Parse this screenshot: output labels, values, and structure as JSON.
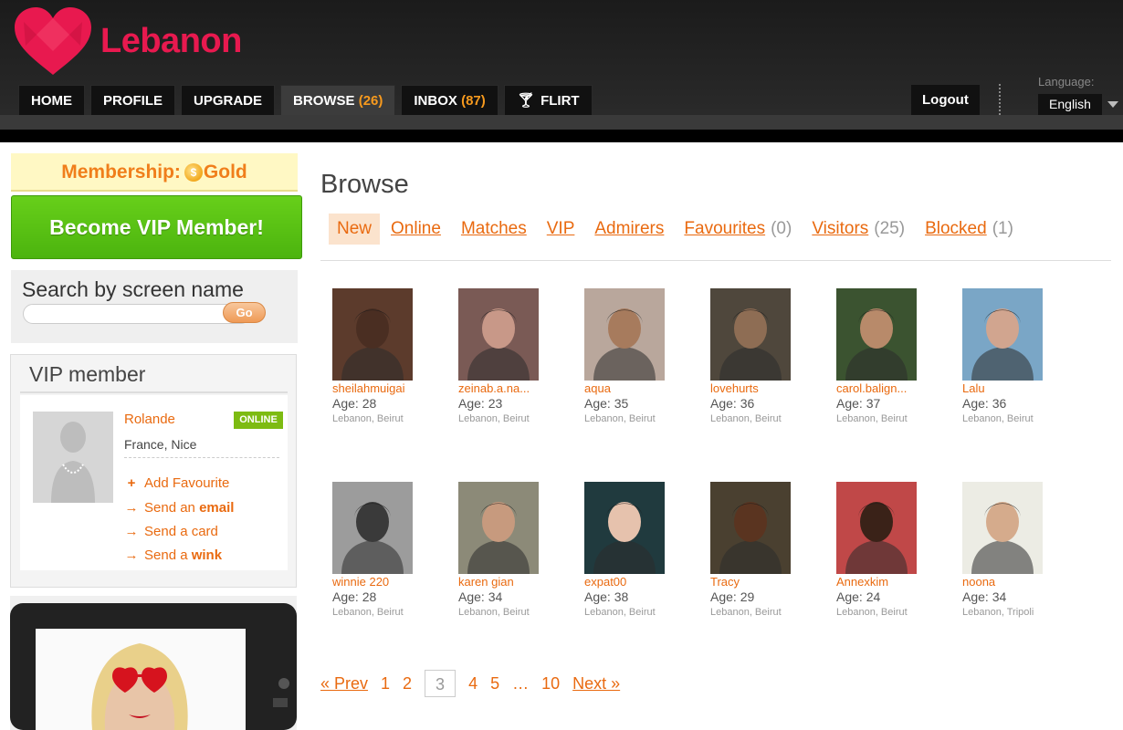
{
  "header": {
    "logo_text": "Lebanon",
    "nav": [
      {
        "label": "HOME",
        "count": ""
      },
      {
        "label": "PROFILE",
        "count": ""
      },
      {
        "label": "UPGRADE",
        "count": ""
      },
      {
        "label": "BROWSE",
        "count": "(26)"
      },
      {
        "label": "INBOX",
        "count": "(87)"
      },
      {
        "label": "FLIRT",
        "count": ""
      }
    ],
    "logout_label": "Logout",
    "language_label": "Language:",
    "language_value": "English"
  },
  "sidebar": {
    "membership_prefix": "Membership:",
    "membership_level": "Gold",
    "vip_button_label": "Become VIP Member!",
    "search_title": "Search by screen name",
    "search_value": "",
    "go_label": "Go",
    "vip_section_title": "VIP member",
    "vip_member": {
      "name": "Rolande",
      "status": "ONLINE",
      "location": "France, Nice",
      "actions": [
        {
          "glyph": "+",
          "text": "Add Favourite",
          "bold": ""
        },
        {
          "glyph": "→",
          "text": "Send an ",
          "bold": "email"
        },
        {
          "glyph": "→",
          "text": "Send a card",
          "bold": ""
        },
        {
          "glyph": "→",
          "text": "Send a ",
          "bold": "wink"
        }
      ]
    }
  },
  "main": {
    "title": "Browse",
    "tabs": [
      {
        "label": "New",
        "count": ""
      },
      {
        "label": "Online",
        "count": ""
      },
      {
        "label": "Matches",
        "count": ""
      },
      {
        "label": "VIP",
        "count": ""
      },
      {
        "label": "Admirers",
        "count": ""
      },
      {
        "label": "Favourites",
        "count": "(0)"
      },
      {
        "label": "Visitors",
        "count": "(25)"
      },
      {
        "label": "Blocked",
        "count": "(1)"
      }
    ],
    "profiles": [
      {
        "name": "sheilahmuigai",
        "age": "Age: 28",
        "location": "Lebanon, Beirut",
        "bg": "#5c3b2c",
        "skin": "#4a2e22"
      },
      {
        "name": "zeinab.a.na...",
        "age": "Age: 23",
        "location": "Lebanon, Beirut",
        "bg": "#7a5a55",
        "skin": "#c89888"
      },
      {
        "name": "aqua",
        "age": "Age: 35",
        "location": "Lebanon, Beirut",
        "bg": "#b9a79c",
        "skin": "#a77b5d"
      },
      {
        "name": "lovehurts",
        "age": "Age: 36",
        "location": "Lebanon, Beirut",
        "bg": "#4f473c",
        "skin": "#8e6d54"
      },
      {
        "name": "carol.balign...",
        "age": "Age: 37",
        "location": "Lebanon, Beirut",
        "bg": "#3b5330",
        "skin": "#b88a6a"
      },
      {
        "name": "Lalu",
        "age": "Age: 36",
        "location": "Lebanon, Beirut",
        "bg": "#7aa6c6",
        "skin": "#d1a58f"
      },
      {
        "name": "winnie 220",
        "age": "Age: 28",
        "location": "Lebanon, Beirut",
        "bg": "#9c9c9c",
        "skin": "#3a3a3a"
      },
      {
        "name": "karen gian",
        "age": "Age: 34",
        "location": "Lebanon, Beirut",
        "bg": "#8c8a78",
        "skin": "#c79a7e"
      },
      {
        "name": "expat00",
        "age": "Age: 38",
        "location": "Lebanon, Beirut",
        "bg": "#203a3e",
        "skin": "#e6c2ad"
      },
      {
        "name": "Tracy",
        "age": "Age: 29",
        "location": "Lebanon, Beirut",
        "bg": "#4a4030",
        "skin": "#5a3420"
      },
      {
        "name": "Annexkim",
        "age": "Age: 24",
        "location": "Lebanon, Beirut",
        "bg": "#c04848",
        "skin": "#3a2218"
      },
      {
        "name": "noona",
        "age": "Age: 34",
        "location": "Lebanon, Tripoli",
        "bg": "#ecece4",
        "skin": "#d5ab8c"
      }
    ],
    "pagination": [
      {
        "label": "« Prev",
        "type": "link"
      },
      {
        "label": "1",
        "type": "page"
      },
      {
        "label": "2",
        "type": "page"
      },
      {
        "label": "3",
        "type": "current"
      },
      {
        "label": "4",
        "type": "page"
      },
      {
        "label": "5",
        "type": "page"
      },
      {
        "label": "…",
        "type": "ellipsis"
      },
      {
        "label": "10",
        "type": "page"
      },
      {
        "label": "Next »",
        "type": "link"
      }
    ]
  },
  "colors": {
    "accent": "#e96a10",
    "brand": "#e8194f",
    "vip_green": "#5cc214",
    "online_green": "#7dbb12"
  }
}
